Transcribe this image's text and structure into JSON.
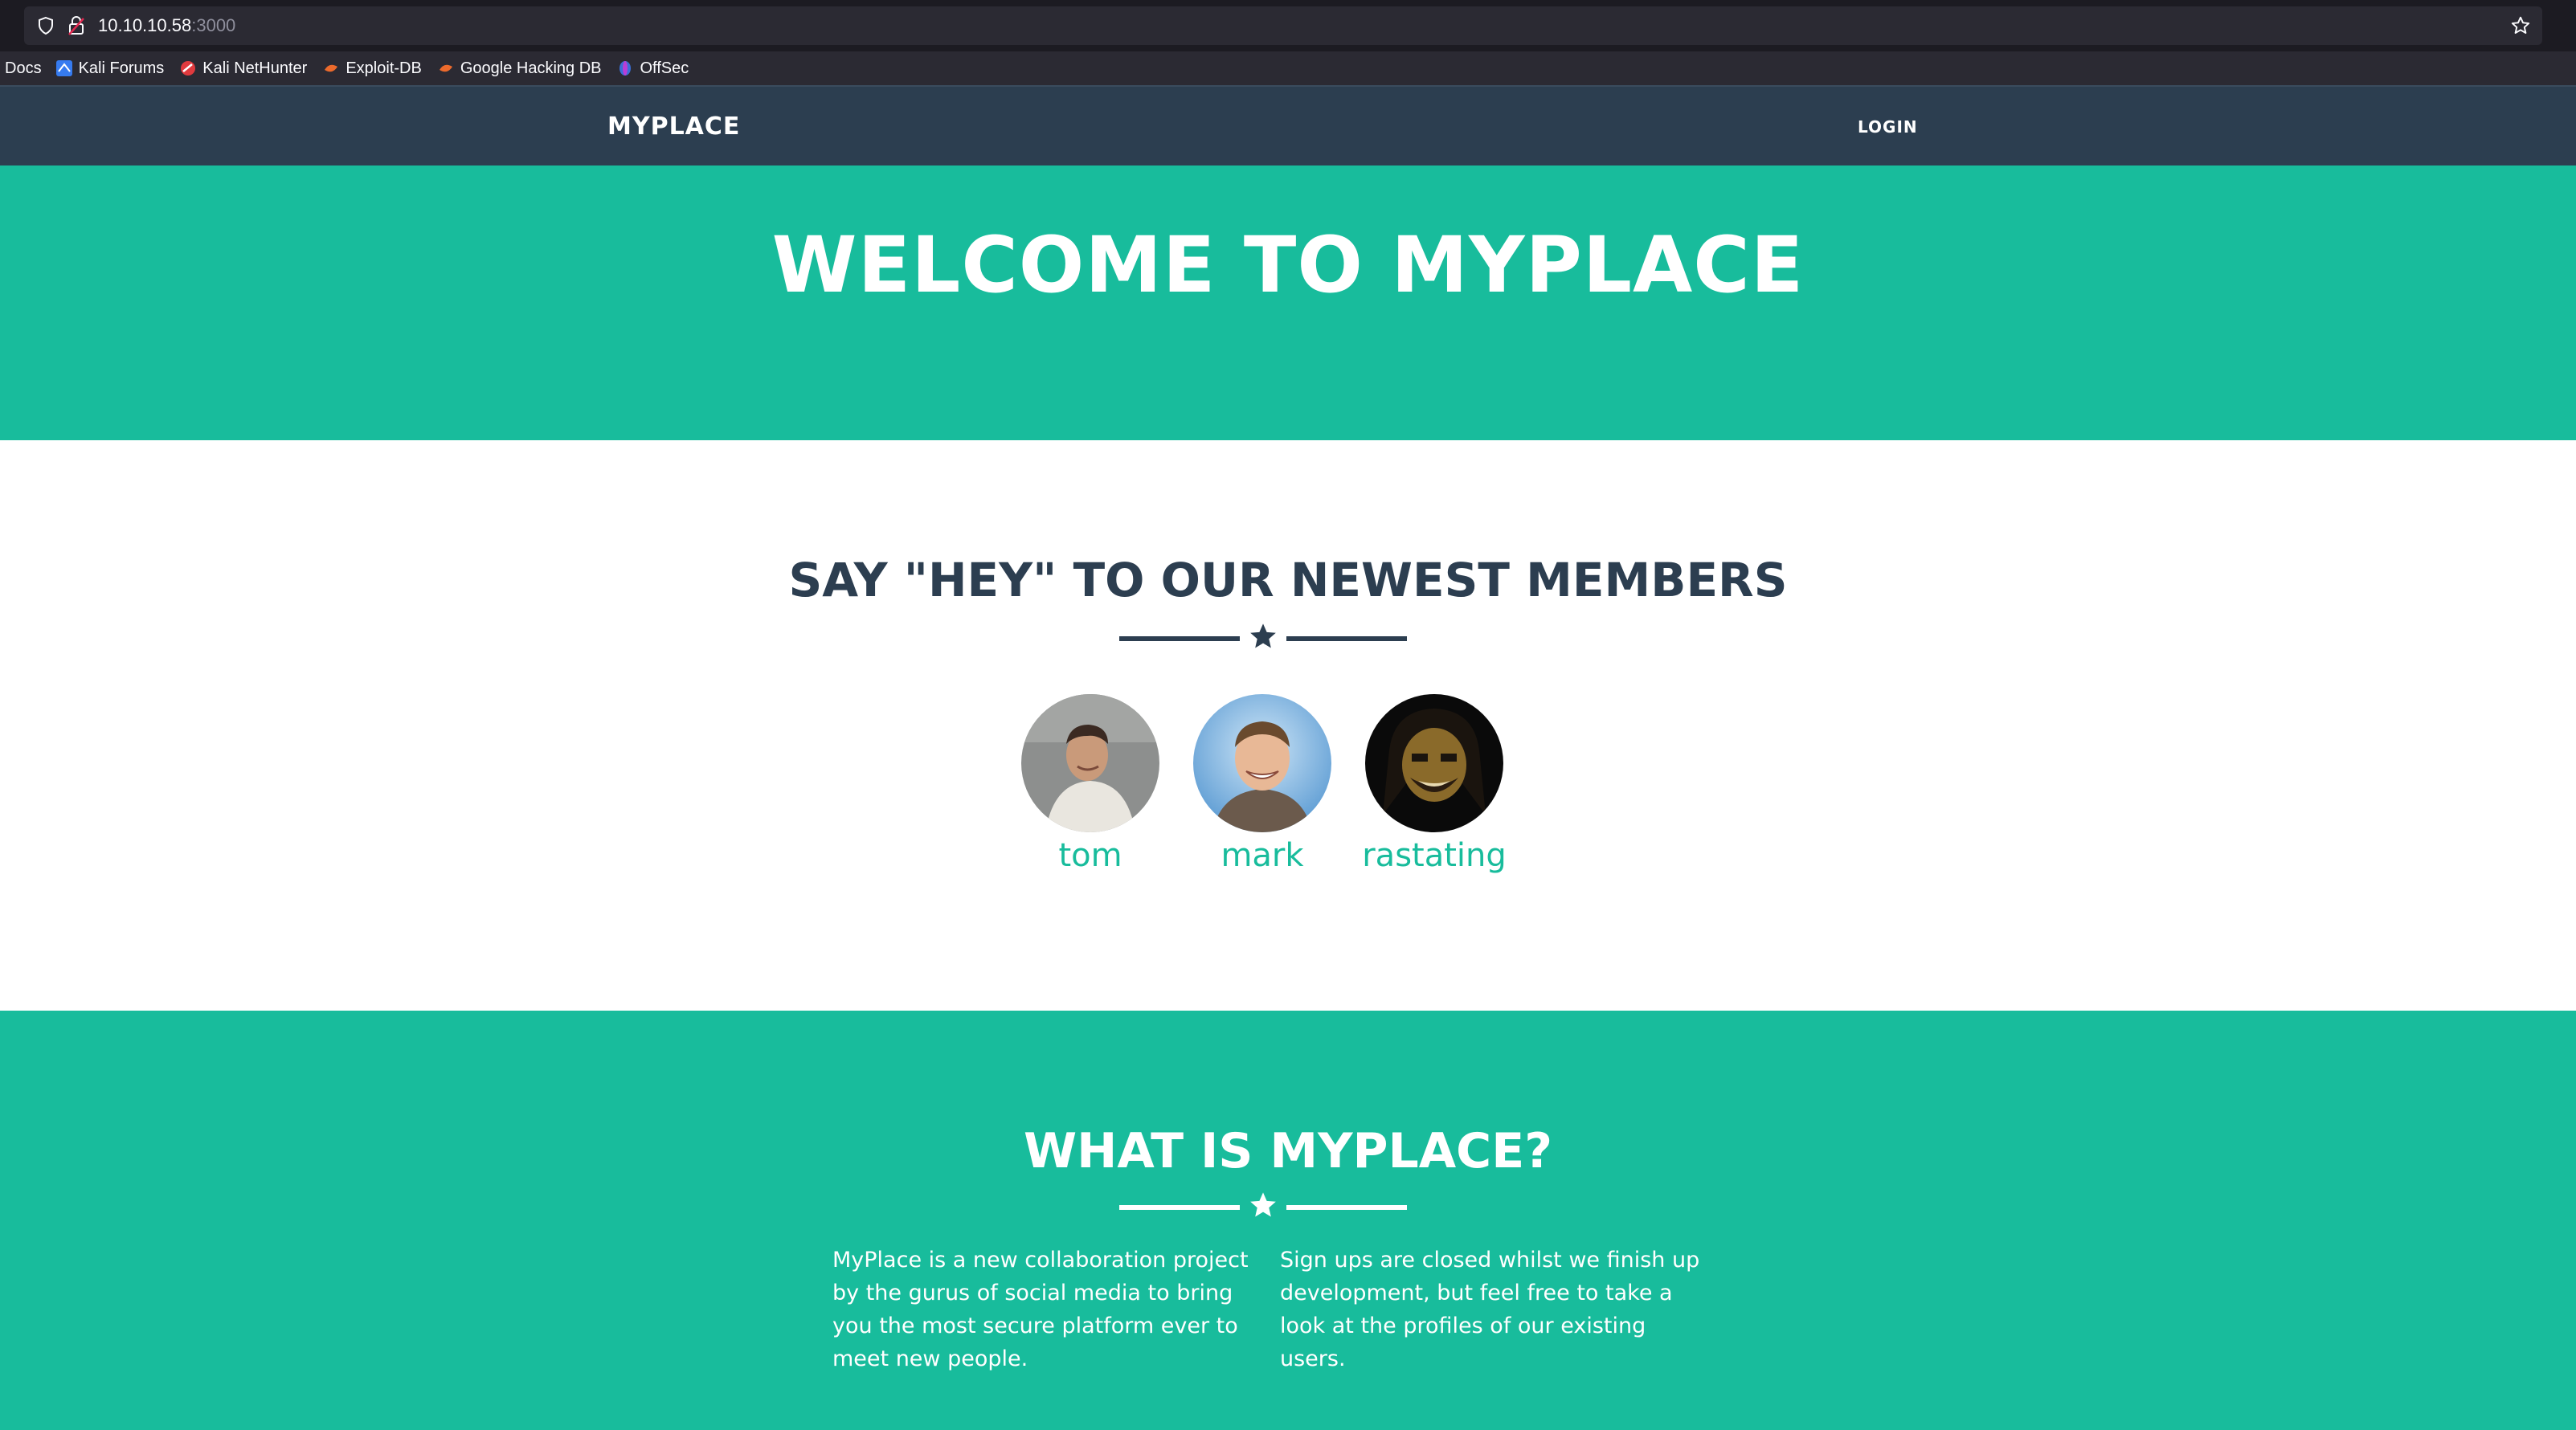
{
  "browser": {
    "url_host": "10.10.10.58",
    "url_port": ":3000",
    "bookmarks": [
      {
        "label": "Docs"
      },
      {
        "label": "Kali Forums",
        "icon": "kali-dragon-icon"
      },
      {
        "label": "Kali NetHunter",
        "icon": "nethunter-icon"
      },
      {
        "label": "Exploit-DB",
        "icon": "exploit-db-icon"
      },
      {
        "label": "Google Hacking DB",
        "icon": "ghdb-icon"
      },
      {
        "label": "OffSec",
        "icon": "offsec-icon"
      }
    ]
  },
  "navbar": {
    "brand": "MYPLACE",
    "login": "LOGIN"
  },
  "hero": {
    "title": "WELCOME TO MYPLACE"
  },
  "members": {
    "heading": "SAY \"HEY\" TO OUR NEWEST MEMBERS",
    "list": [
      {
        "name": "tom"
      },
      {
        "name": "mark"
      },
      {
        "name": "rastating"
      }
    ]
  },
  "about": {
    "heading": "WHAT IS MYPLACE?",
    "col1": "MyPlace is a new collaboration project by the gurus of social media to bring you the most secure platform ever to meet new people.",
    "col2": "Sign ups are closed whilst we finish up development, but feel free to take a look at the profiles of our existing users."
  },
  "colors": {
    "primary": "#2c3e50",
    "accent": "#18bc9c"
  }
}
